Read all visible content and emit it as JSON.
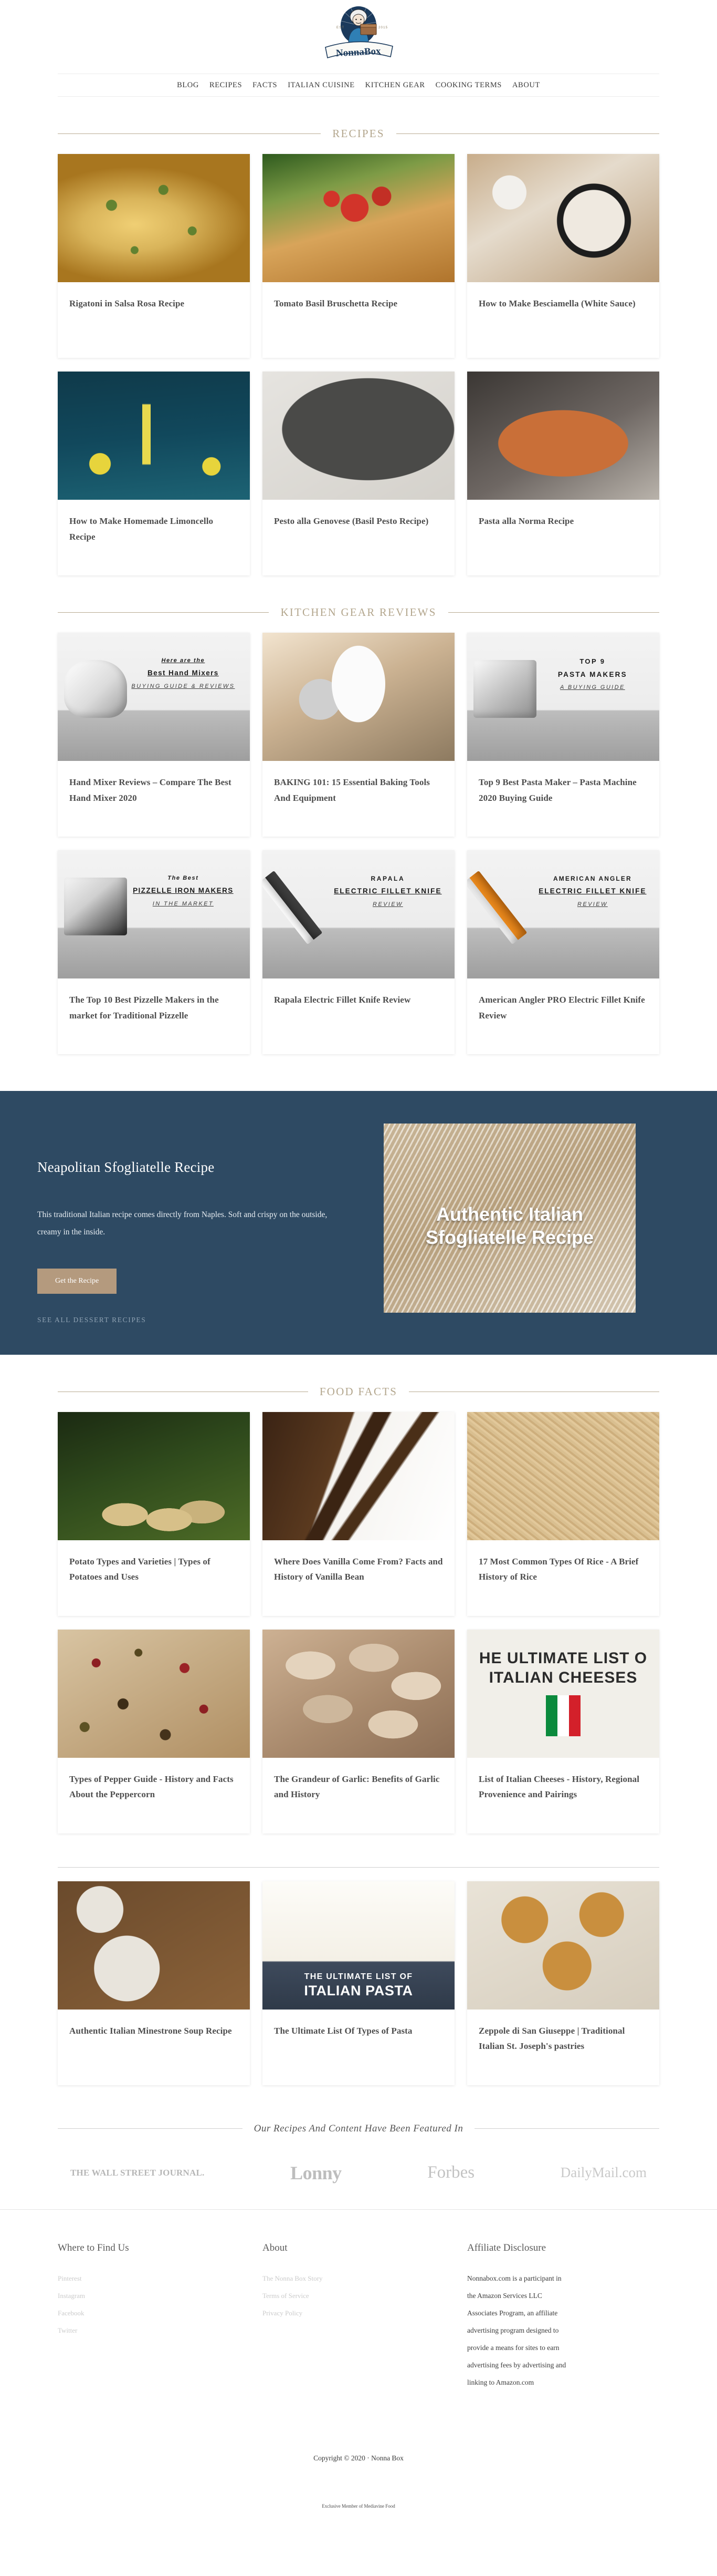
{
  "header": {
    "logo_alt": "Nonna Box",
    "logo_est_left": "EST",
    "logo_est_right": "2015",
    "logo_wordmark": "NONNA BOX",
    "nav": [
      "BLOG",
      "RECIPES",
      "FACTS",
      "ITALIAN CUISINE",
      "KITCHEN GEAR",
      "COOKING TERMS",
      "ABOUT"
    ]
  },
  "sections": {
    "recipes": {
      "title": "RECIPES",
      "cards": [
        {
          "title": "Rigatoni in Salsa Rosa Recipe",
          "art": "art-rigatoni"
        },
        {
          "title": "Tomato Basil Bruschetta Recipe",
          "art": "art-bruschetta"
        },
        {
          "title": "How to Make Besciamella (White Sauce)",
          "art": "art-besciamella"
        },
        {
          "title": "How to Make Homemade Limoncello Recipe",
          "art": "art-limoncello"
        },
        {
          "title": "Pesto alla Genovese (Basil Pesto Recipe)",
          "art": "art-pesto"
        },
        {
          "title": "Pasta alla Norma Recipe",
          "art": "art-norma"
        }
      ]
    },
    "kitchen_gear": {
      "title": "KITCHEN GEAR REVIEWS",
      "cards": [
        {
          "title": "Hand Mixer Reviews – Compare The Best Hand Mixer 2020",
          "art": "art-gear",
          "overlay": {
            "l1": "Here are the",
            "l2": "Best Hand Mixers",
            "l3": "BUYING GUIDE & REVIEWS"
          },
          "appliance": "mixer"
        },
        {
          "title": "BAKING 101: 15 Essential Baking Tools And Equipment",
          "art": "art-baking",
          "overlay": null,
          "appliance": null
        },
        {
          "title": "Top 9 Best Pasta Maker – Pasta Machine 2020 Buying Guide",
          "art": "art-gear",
          "overlay": {
            "l1": "TOP 9",
            "l2": "PASTA MAKERS",
            "l3": "A BUYING GUIDE"
          },
          "appliance": "pasta"
        },
        {
          "title": "The Top 10 Best Pizzelle Makers in the market for Traditional Pizzelle",
          "art": "art-gear",
          "overlay": {
            "l1": "The Best",
            "l2": "PIZZELLE IRON MAKERS",
            "l3": "IN THE MARKET"
          },
          "appliance": "pizzelle"
        },
        {
          "title": "Rapala Electric Fillet Knife Review",
          "art": "art-gear",
          "overlay": {
            "l1": "RAPALA",
            "l2": "ELECTRIC FILLET KNIFE",
            "l3": "REVIEW"
          },
          "appliance": "knife"
        },
        {
          "title": "American Angler PRO Electric Fillet Knife Review",
          "art": "art-gear",
          "overlay": {
            "l1": "AMERICAN ANGLER",
            "l2": "ELECTRIC FILLET KNIFE",
            "l3": "REVIEW"
          },
          "appliance": "knife-orange"
        }
      ]
    },
    "feature": {
      "title": "Neapolitan Sfogliatelle Recipe",
      "description": "This traditional Italian recipe comes directly from Naples. Soft and crispy on the outside, creamy in the inside.",
      "button": "Get the Recipe",
      "link": "SEE ALL DESSERT RECIPES",
      "image_caption_line1": "Authentic Italian",
      "image_caption_line2": "Sfogliatelle Recipe",
      "bg_color": "#2e4a63",
      "button_color": "#b49a7e"
    },
    "food_facts": {
      "title": "FOOD FACTS",
      "cards": [
        {
          "title": "Potato Types and Varieties | Types of Potatoes and Uses",
          "art": "art-potato"
        },
        {
          "title": "Where Does Vanilla Come From? Facts and History of Vanilla Bean",
          "art": "art-vanilla"
        },
        {
          "title": "17 Most Common Types Of Rice - A Brief History of Rice",
          "art": "art-rice"
        },
        {
          "title": "Types of Pepper Guide - History and Facts About the Peppercorn",
          "art": "art-pepper"
        },
        {
          "title": "The Grandeur of Garlic: Benefits of Garlic and History",
          "art": "art-garlic"
        },
        {
          "title": "List of Italian Cheeses - History, Regional Provenience and Pairings",
          "art": "art-cheeses",
          "overlay_text": "HE ULTIMATE LIST O\nITALIAN CHEESES"
        }
      ]
    },
    "more_posts": {
      "cards": [
        {
          "title": "Authentic Italian Minestrone Soup Recipe",
          "art": "art-minestrone"
        },
        {
          "title": "The Ultimate List Of Types of Pasta",
          "art": "art-pastalist",
          "band1": "THE ULTIMATE LIST OF",
          "band2": "ITALIAN PASTA"
        },
        {
          "title": "Zeppole di San Giuseppe | Traditional Italian St. Joseph's pastries",
          "art": "art-zeppole"
        }
      ]
    },
    "featured_in": {
      "title": "Our Recipes And Content Have Been Featured In",
      "logos": [
        "THE WALL STREET JOURNAL.",
        "Lonny",
        "Forbes",
        "DailyMail.com"
      ]
    }
  },
  "footer": {
    "columns": [
      {
        "title": "Where to Find Us",
        "items": [
          "Pinterest",
          "Instagram",
          "Facebook",
          "Twitter"
        ]
      },
      {
        "title": "About",
        "items": [
          "The Nonna Box Story",
          "Terms of Service",
          "Privacy Policy"
        ]
      }
    ],
    "affiliate_title": "Affiliate Disclosure",
    "affiliate_text": "Nonnabox.com is a participant in the Amazon Services LLC Associates Program, an affiliate advertising program designed to provide a means for sites to earn advertising fees by advertising and linking to Amazon.com",
    "copyright": "Copyright © 2020 · Nonna Box",
    "mediavine": "Exclusive Member of Mediavine Food"
  }
}
